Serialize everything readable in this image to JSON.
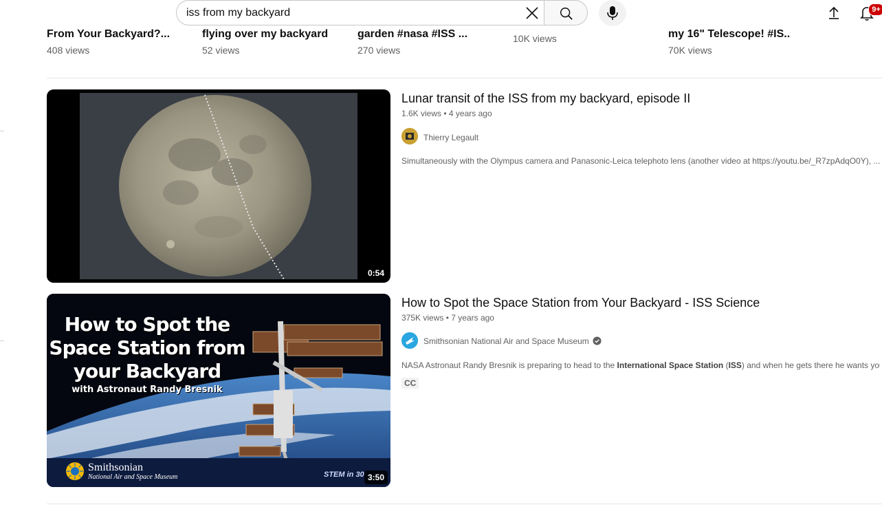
{
  "search": {
    "query": "iss from my backyard",
    "placeholder": "Search"
  },
  "header": {
    "notification_count": "9+"
  },
  "shelf": [
    {
      "title": "From Your Backyard?...",
      "views": "408 views"
    },
    {
      "title": "flying over my backyard",
      "views": "52 views"
    },
    {
      "title": "garden #nasa #ISS ...",
      "views": "270 views"
    },
    {
      "title": "",
      "views": "10K views"
    },
    {
      "title": "my 16\" Telescope! #IS..",
      "views": "70K views"
    }
  ],
  "videos": [
    {
      "title": "Lunar transit of the ISS from my backyard, episode II",
      "views": "1.6K views",
      "age": "4 years ago",
      "channel": "Thierry Legault",
      "description": "Simultaneously with the Olympus camera and Panasonic-Leica telephoto lens (another video at https://youtu.be/_R7zpAdqO0Y), ...",
      "duration": "0:54"
    },
    {
      "title": "How to Spot the Space Station from Your Backyard - ISS Science",
      "views": "375K views",
      "age": "7 years ago",
      "channel": "Smithsonian National Air and Space Museum",
      "description_pre": "NASA Astronaut Randy Bresnik is preparing to head to the ",
      "description_bold1": "International Space Station",
      "description_mid": " (",
      "description_bold2": "ISS",
      "description_post": ") and when he gets there he wants you ...",
      "cc": "CC",
      "duration": "3:50",
      "thumb_line1": "How to Spot the",
      "thumb_line2": "Space Station from",
      "thumb_line3": "your Backyard",
      "thumb_sub": "with Astronaut Randy Bresnik",
      "thumb_brand": "Smithsonian",
      "thumb_brand_sub": "National Air and Space Museum",
      "thumb_stem": "STEM in 30"
    }
  ],
  "colors": {
    "badge": "#cc0000",
    "meta_text": "#606060",
    "title_text": "#0f0f0f"
  }
}
